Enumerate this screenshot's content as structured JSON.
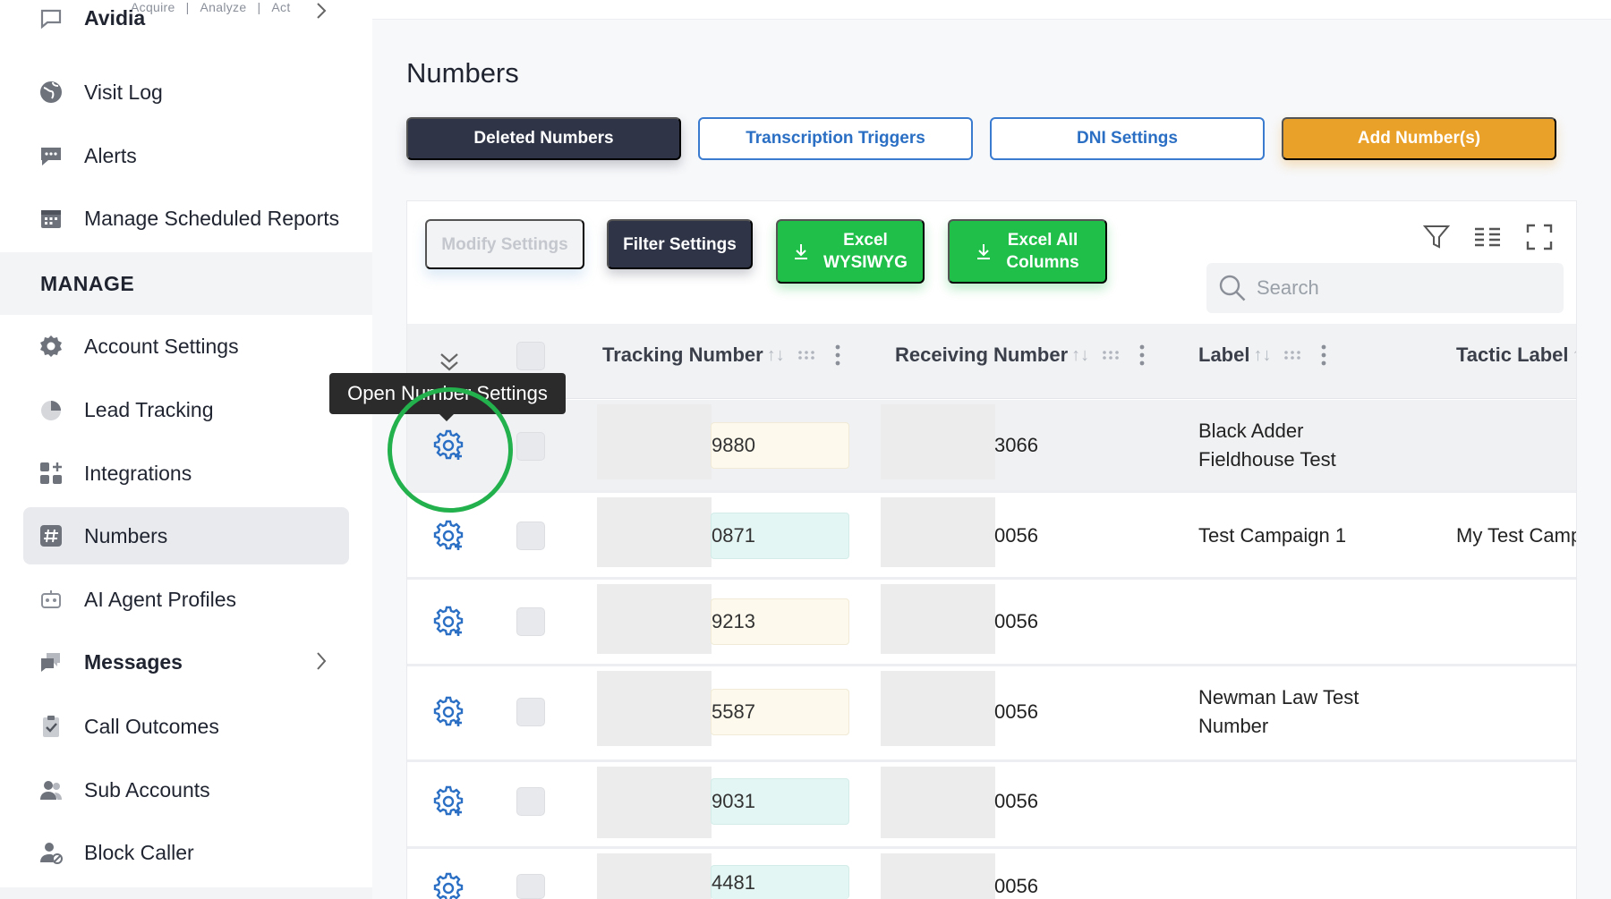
{
  "tagline": {
    "parts": [
      "Acquire",
      "Analyze",
      "Act"
    ]
  },
  "sidebar": {
    "items_top": [
      {
        "label": "Avidia",
        "icon": "chat-icon"
      },
      {
        "label": "Visit Log",
        "icon": "globe-icon"
      },
      {
        "label": "Alerts",
        "icon": "alert-bubble-icon"
      },
      {
        "label": "Manage Scheduled Reports",
        "icon": "calendar-icon"
      }
    ],
    "section": "MANAGE",
    "items": [
      {
        "label": "Account Settings",
        "icon": "gear-icon"
      },
      {
        "label": "Lead Tracking",
        "icon": "pie-chart-icon"
      },
      {
        "label": "Integrations",
        "icon": "grid-plus-icon"
      },
      {
        "label": "Numbers",
        "icon": "hash-icon",
        "active": true
      },
      {
        "label": "AI Agent Profiles",
        "icon": "robot-icon"
      },
      {
        "label": "Messages",
        "icon": "message-bubbles-icon"
      },
      {
        "label": "Call Outcomes",
        "icon": "clipboard-check-icon"
      },
      {
        "label": "Sub Accounts",
        "icon": "users-icon"
      },
      {
        "label": "Block Caller",
        "icon": "user-block-icon"
      }
    ]
  },
  "page": {
    "title": "Numbers"
  },
  "actions": {
    "deleted": "Deleted Numbers",
    "transcription": "Transcription Triggers",
    "dni": "DNI Settings",
    "add": "Add Number(s)"
  },
  "toolbar": {
    "modify": "Modify Settings",
    "filter": "Filter Settings",
    "excel_wysiwyg_1": "Excel",
    "excel_wysiwyg_2": "WYSIWYG",
    "excel_all_1": "Excel All",
    "excel_all_2": "Columns",
    "search_placeholder": "Search"
  },
  "table": {
    "columns": {
      "tracking": "Tracking Number",
      "receiving": "Receiving Number",
      "label": "Label",
      "tactic": "Tactic Label"
    },
    "rows": [
      {
        "tracking": "9880",
        "receiving": "3066",
        "label_1": "Black Adder",
        "label_2": "Fieldhouse Test",
        "tactic": ""
      },
      {
        "tracking": "0871",
        "receiving": "0056",
        "label_1": "Test Campaign 1",
        "label_2": "",
        "tactic": "My Test Camp"
      },
      {
        "tracking": "9213",
        "receiving": "0056",
        "label_1": "",
        "label_2": "",
        "tactic": ""
      },
      {
        "tracking": "5587",
        "receiving": "0056",
        "label_1": "Newman Law Test",
        "label_2": "Number",
        "tactic": ""
      },
      {
        "tracking": "9031",
        "receiving": "0056",
        "label_1": "",
        "label_2": "",
        "tactic": ""
      },
      {
        "tracking": "4481",
        "receiving": "0056",
        "label_1": "",
        "label_2": "",
        "tactic": ""
      }
    ]
  },
  "tooltip": {
    "text": "Open Number Settings"
  },
  "colors": {
    "accent_dark": "#2f3447",
    "accent_blue": "#2a6fc4",
    "orange": "#eaa12a",
    "green": "#1fbf4a",
    "highlight": "#22b14c"
  }
}
